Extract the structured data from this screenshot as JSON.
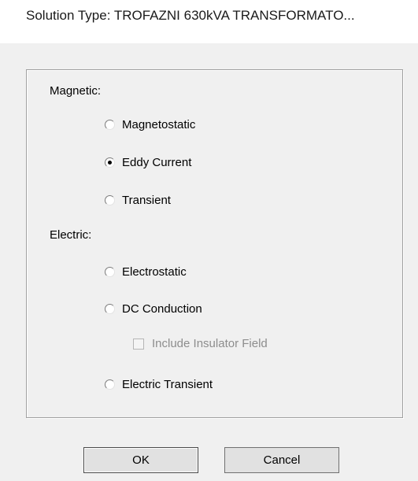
{
  "window": {
    "title": "Solution Type: TROFAZNI 630kVA TRANSFORMATO..."
  },
  "magnetic": {
    "label": "Magnetic:",
    "options": [
      {
        "label": "Magnetostatic",
        "selected": false
      },
      {
        "label": "Eddy Current",
        "selected": true
      },
      {
        "label": "Transient",
        "selected": false
      }
    ]
  },
  "electric": {
    "label": "Electric:",
    "options": [
      {
        "label": "Electrostatic",
        "selected": false
      },
      {
        "label": "DC Conduction",
        "selected": false
      },
      {
        "label": "Electric Transient",
        "selected": false
      }
    ],
    "include_insulator": {
      "label": "Include Insulator Field",
      "checked": false,
      "enabled": false
    }
  },
  "buttons": {
    "ok": "OK",
    "cancel": "Cancel"
  }
}
